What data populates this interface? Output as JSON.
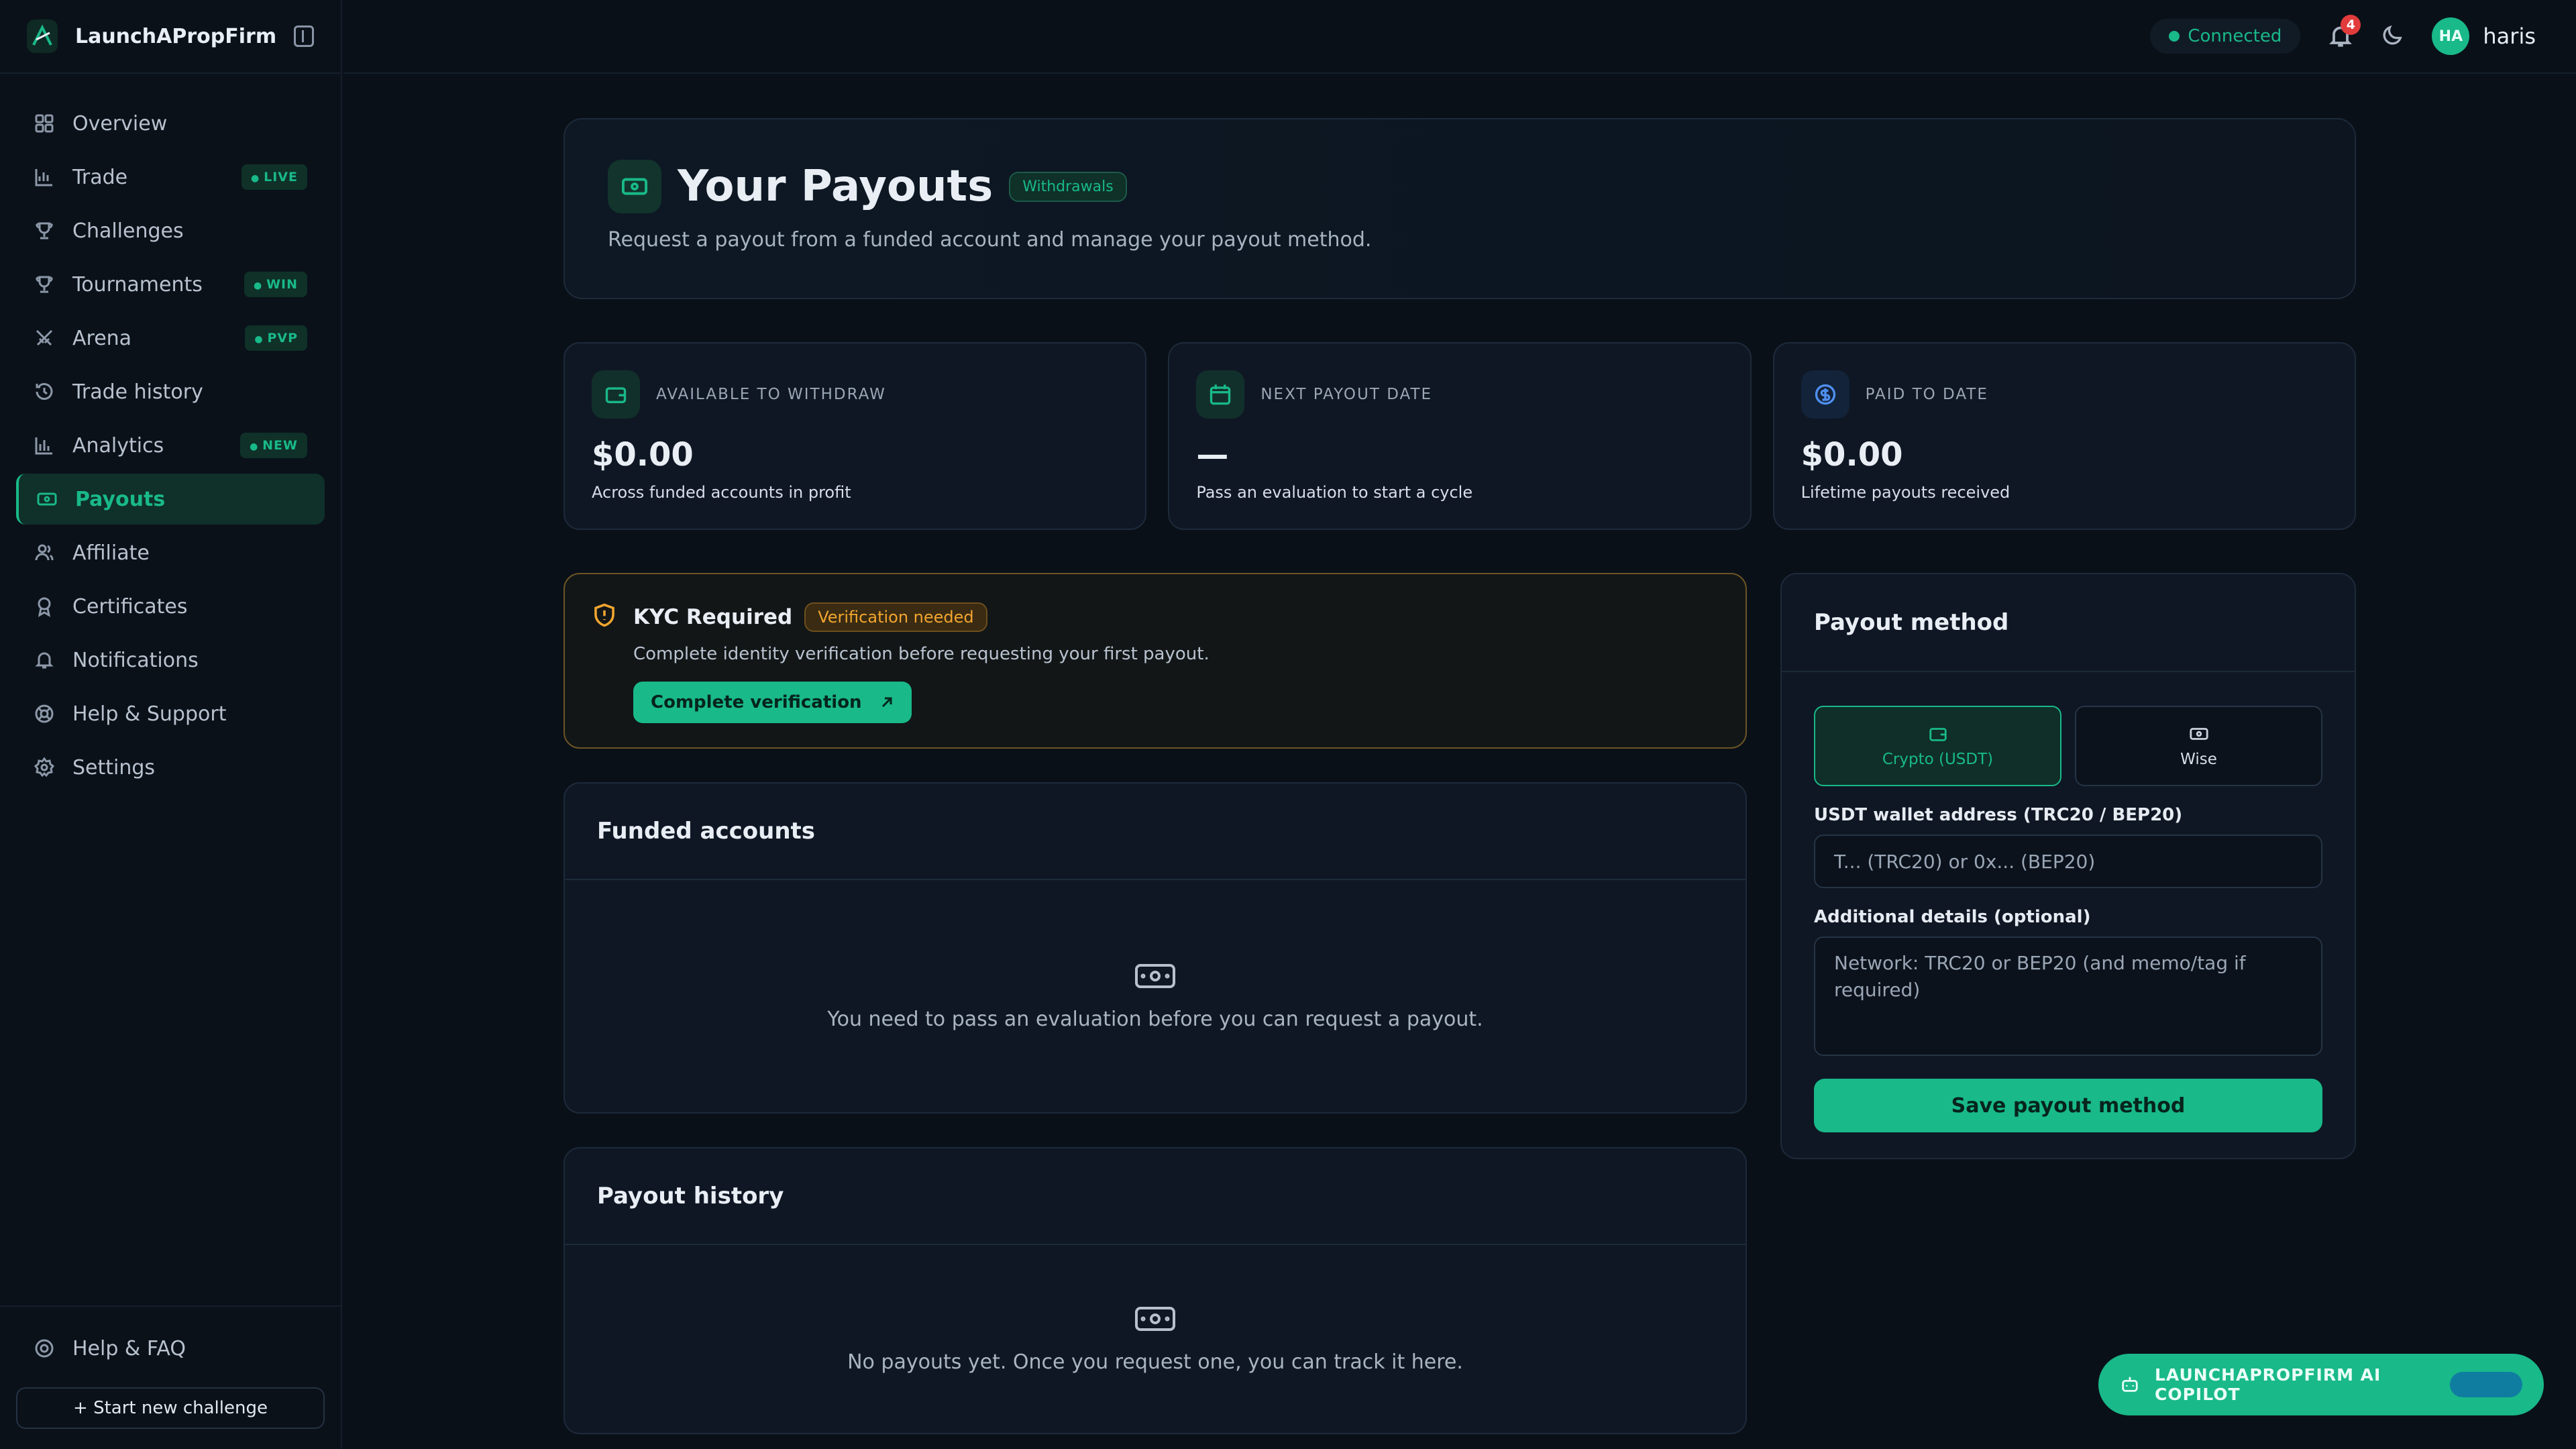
{
  "brand": {
    "name": "LaunchAPropFirm"
  },
  "sidebar": {
    "items": [
      {
        "label": "Overview",
        "icon": "grid-icon"
      },
      {
        "label": "Trade",
        "icon": "chart-icon",
        "pill": "LIVE"
      },
      {
        "label": "Challenges",
        "icon": "trophy-icon"
      },
      {
        "label": "Tournaments",
        "icon": "trophy-icon",
        "pill": "WIN"
      },
      {
        "label": "Arena",
        "icon": "swords-icon",
        "pill": "PVP"
      },
      {
        "label": "Trade history",
        "icon": "history-icon"
      },
      {
        "label": "Analytics",
        "icon": "bar-chart-icon",
        "pill": "NEW"
      },
      {
        "label": "Payouts",
        "icon": "cash-icon",
        "active": true
      },
      {
        "label": "Affiliate",
        "icon": "users-icon"
      },
      {
        "label": "Certificates",
        "icon": "award-icon"
      },
      {
        "label": "Notifications",
        "icon": "bell-icon"
      },
      {
        "label": "Help & Support",
        "icon": "lifebuoy-icon"
      },
      {
        "label": "Settings",
        "icon": "gear-icon"
      }
    ],
    "help_faq": "Help & FAQ",
    "start_challenge": "+ Start new challenge"
  },
  "topbar": {
    "status": "Connected",
    "notifications_count": "4",
    "user_initials": "HA",
    "username": "haris"
  },
  "hero": {
    "title": "Your Payouts",
    "tag": "Withdrawals",
    "subtitle": "Request a payout from a funded account and manage your payout method."
  },
  "stats": [
    {
      "label": "AVAILABLE TO WITHDRAW",
      "value": "$0.00",
      "note": "Across funded accounts in profit",
      "icon": "wallet-icon"
    },
    {
      "label": "NEXT PAYOUT DATE",
      "value": "—",
      "note": "Pass an evaluation to start a cycle",
      "icon": "calendar-icon"
    },
    {
      "label": "PAID TO DATE",
      "value": "$0.00",
      "note": "Lifetime payouts received",
      "icon": "dollar-icon"
    }
  ],
  "kyc": {
    "title": "KYC Required",
    "tag": "Verification needed",
    "subtitle": "Complete identity verification before requesting your first payout.",
    "button": "Complete verification"
  },
  "funded": {
    "title": "Funded accounts",
    "empty": "You need to pass an evaluation before you can request a payout."
  },
  "history": {
    "title": "Payout history",
    "empty": "No payouts yet. Once you request one, you can track it here."
  },
  "method": {
    "title": "Payout method",
    "options": [
      "Crypto (USDT)",
      "Wise"
    ],
    "wallet_label": "USDT wallet address (TRC20 / BEP20)",
    "wallet_placeholder": "T... (TRC20) or 0x... (BEP20)",
    "details_label": "Additional details (optional)",
    "details_placeholder": "Network: TRC20 or BEP20 (and memo/tag if required)",
    "save": "Save payout method"
  },
  "copilot": {
    "label": "LAUNCHAPROPFIRM AI COPILOT"
  },
  "colors": {
    "accent": "#19b989",
    "warning": "#f2a530",
    "background": "#0a1018"
  }
}
